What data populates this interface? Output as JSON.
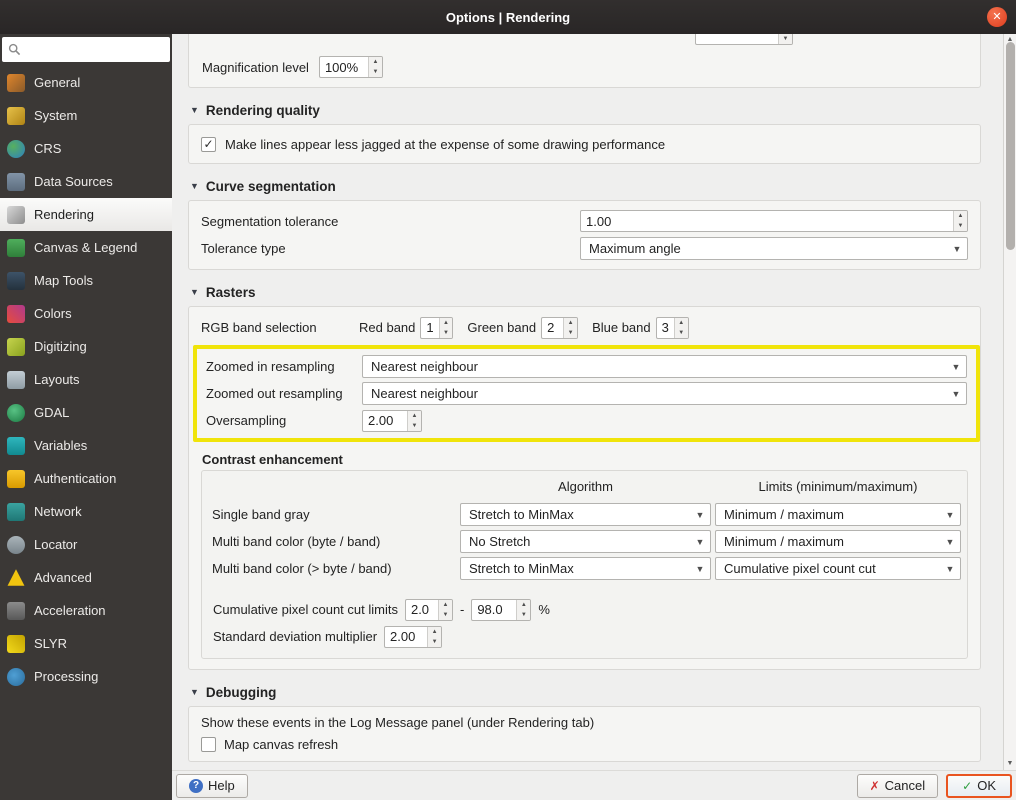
{
  "window": {
    "title": "Options | Rendering"
  },
  "sidebar": {
    "search": {
      "placeholder": ""
    },
    "items": [
      {
        "label": "General",
        "icon": "wrench-icon"
      },
      {
        "label": "System",
        "icon": "gears-icon"
      },
      {
        "label": "CRS",
        "icon": "globe-crs-icon"
      },
      {
        "label": "Data Sources",
        "icon": "database-icon"
      },
      {
        "label": "Rendering",
        "icon": "paintbrush-icon",
        "selected": true
      },
      {
        "label": "Canvas & Legend",
        "icon": "canvas-legend-icon"
      },
      {
        "label": "Map Tools",
        "icon": "map-tools-icon"
      },
      {
        "label": "Colors",
        "icon": "color-palette-icon"
      },
      {
        "label": "Digitizing",
        "icon": "digitizing-icon"
      },
      {
        "label": "Layouts",
        "icon": "layouts-icon"
      },
      {
        "label": "GDAL",
        "icon": "gdal-globe-icon"
      },
      {
        "label": "Variables",
        "icon": "variables-icon"
      },
      {
        "label": "Authentication",
        "icon": "lock-icon"
      },
      {
        "label": "Network",
        "icon": "network-icon"
      },
      {
        "label": "Locator",
        "icon": "magnifier-icon"
      },
      {
        "label": "Advanced",
        "icon": "warning-triangle-icon"
      },
      {
        "label": "Acceleration",
        "icon": "chip-icon"
      },
      {
        "label": "SLYR",
        "icon": "slyr-icon"
      },
      {
        "label": "Processing",
        "icon": "processing-gear-icon"
      }
    ]
  },
  "main": {
    "magnification": {
      "label": "Magnification level",
      "value": "100%"
    },
    "rendering_quality": {
      "title": "Rendering quality",
      "antialias_label": "Make lines appear less jagged at the expense of some drawing performance",
      "antialias_checked": true
    },
    "curve_segmentation": {
      "title": "Curve segmentation",
      "tolerance_label": "Segmentation tolerance",
      "tolerance_value": "1.00",
      "type_label": "Tolerance type",
      "type_value": "Maximum angle"
    },
    "rasters": {
      "title": "Rasters",
      "rgb_label": "RGB band selection",
      "red_label": "Red band",
      "red_value": "1",
      "green_label": "Green band",
      "green_value": "2",
      "blue_label": "Blue band",
      "blue_value": "3",
      "zoomed_in_label": "Zoomed in resampling",
      "zoomed_in_value": "Nearest neighbour",
      "zoomed_out_label": "Zoomed out resampling",
      "zoomed_out_value": "Nearest neighbour",
      "oversampling_label": "Oversampling",
      "oversampling_value": "2.00"
    },
    "contrast": {
      "title": "Contrast enhancement",
      "col_algorithm": "Algorithm",
      "col_limits": "Limits (minimum/maximum)",
      "rows": [
        {
          "label": "Single band gray",
          "algorithm": "Stretch to MinMax",
          "limits": "Minimum / maximum"
        },
        {
          "label": "Multi band color (byte / band)",
          "algorithm": "No Stretch",
          "limits": "Minimum / maximum"
        },
        {
          "label": "Multi band color (> byte / band)",
          "algorithm": "Stretch to MinMax",
          "limits": "Cumulative pixel count cut"
        }
      ],
      "cumulative_label": "Cumulative pixel count cut limits",
      "cumulative_min": "2.0",
      "range_separator": "-",
      "cumulative_max": "98.0",
      "percent_sign": "%",
      "stddev_label": "Standard deviation multiplier",
      "stddev_value": "2.00"
    },
    "debugging": {
      "title": "Debugging",
      "log_label": "Show these events in the Log Message panel (under Rendering tab)",
      "map_refresh_label": "Map canvas refresh",
      "map_refresh_checked": false
    }
  },
  "footer": {
    "help_label": "Help",
    "cancel_label": "Cancel",
    "ok_label": "OK"
  },
  "colors": {
    "highlight_yellow": "#f0e40a",
    "accent_orange": "#e9541f",
    "titlebar": "#2c2a29"
  }
}
